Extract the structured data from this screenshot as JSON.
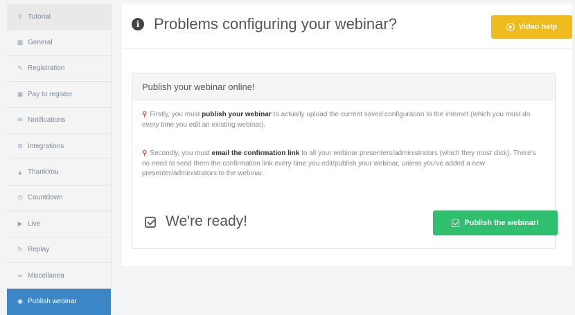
{
  "sidebar": {
    "items": [
      {
        "label": "Tutorial",
        "icon": "lightbulb-icon"
      },
      {
        "label": "General",
        "icon": "grid-icon"
      },
      {
        "label": "Registration",
        "icon": "edit-icon"
      },
      {
        "label": "Pay to register",
        "icon": "card-icon"
      },
      {
        "label": "Notifications",
        "icon": "envelope-icon"
      },
      {
        "label": "Integrations",
        "icon": "gear-icon"
      },
      {
        "label": "ThankYou",
        "icon": "thumbs-up-icon"
      },
      {
        "label": "Countdown",
        "icon": "clock-icon"
      },
      {
        "label": "Live",
        "icon": "video-icon"
      },
      {
        "label": "Replay",
        "icon": "refresh-icon"
      },
      {
        "label": "Miscellanea",
        "icon": "link-icon"
      },
      {
        "label": "Publish webinar",
        "icon": "globe-icon"
      }
    ],
    "active_index": 11
  },
  "header": {
    "title": "Problems configuring your webinar?",
    "video_help_label": "Video help"
  },
  "panel": {
    "title": "Publish your webinar online!",
    "para1": {
      "before": "Firstly, you must ",
      "bold": "publish your webinar",
      "after": " to actually upload the current saved configuration to the internet (which you must do every time you edit an existing webinar)."
    },
    "para2": {
      "before": "Secondly, you must ",
      "bold": "email the confirmation link",
      "after": " to all your webinar presenters/administrators (which they must click). There's no need to send them the confirmation link every time you edit/publish your webinar, unless you've added a new presenter/administrators to the webinar."
    },
    "ready_text": "We're ready!",
    "publish_label": "Publish the webinar!"
  },
  "colors": {
    "active_nav": "#3b86c6",
    "video_help": "#f0bb1d",
    "publish": "#2fbf6e",
    "bulb": "#e2534a"
  }
}
